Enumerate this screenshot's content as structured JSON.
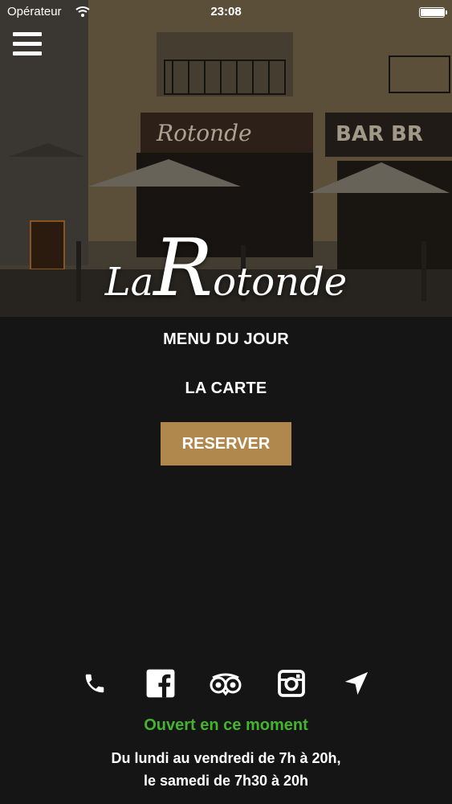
{
  "status_bar": {
    "carrier": "Opérateur",
    "time": "23:08",
    "battery_level": 0.95
  },
  "hero": {
    "logo_la": "La",
    "logo_r": "R",
    "logo_rest": "otonde",
    "sign_text": "Rotonde",
    "sign_text_2": "BAR BR"
  },
  "menu": {
    "menu_du_jour": "MENU DU JOUR",
    "la_carte": "LA CARTE",
    "reserve": "RESERVER"
  },
  "social": {
    "icons": [
      "phone-icon",
      "facebook-icon",
      "tripadvisor-icon",
      "instagram-icon",
      "location-arrow-icon"
    ]
  },
  "footer": {
    "status": "Ouvert en ce moment",
    "hours_line1": "Du lundi au vendredi de 7h à 20h,",
    "hours_line2": "le samedi de 7h30 à 20h"
  },
  "colors": {
    "accent": "#b0884d",
    "open_status": "#43b52d",
    "background": "#161515"
  }
}
